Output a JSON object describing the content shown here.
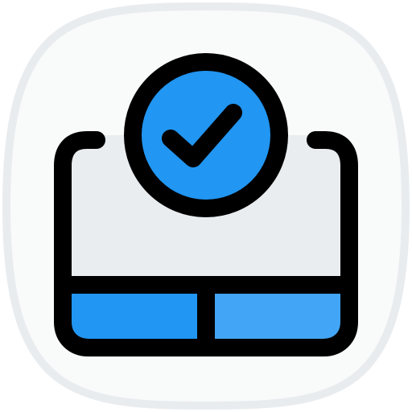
{
  "icon": {
    "name": "touchpad-check-icon",
    "colors": {
      "tile_fill": "#f9fafa",
      "tile_border": "#e9ecef",
      "screen_fill": "#e9edf0",
      "left_button": "#2196f3",
      "right_button": "#42a5f5",
      "badge_fill": "#2196f3",
      "outline": "#000000"
    }
  }
}
